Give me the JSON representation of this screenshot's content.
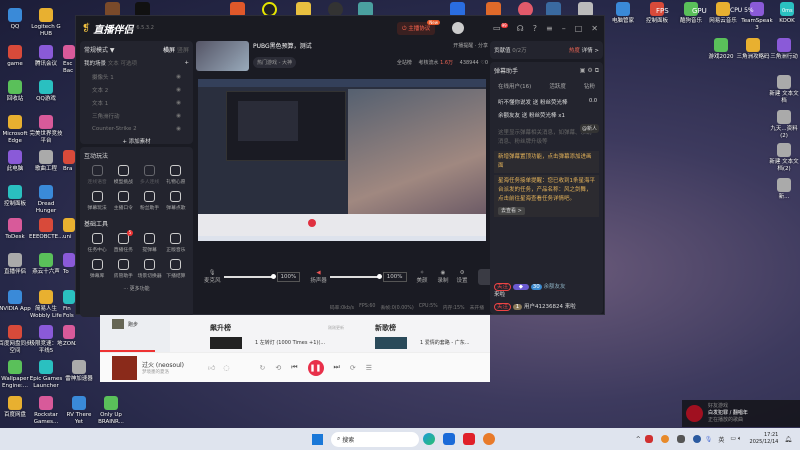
{
  "desktop": {
    "col1": [
      "QQ",
      "game",
      "回收站",
      "Microsoft Edge",
      "此电脑",
      "控制面板",
      "ToDesk",
      "直播伴侣",
      "NVIDIA App",
      "百度网盘同步空间",
      "Wallpaper Engine:...",
      "百度网盘"
    ],
    "col2": [
      "Logitech G HUB",
      "腾讯会议",
      "QQ游戏",
      "完美世界竞技平台",
      "歌曲工程",
      "Dread Hunger",
      "EEEOBCTE...",
      "燕云十六声",
      "简易人生 Wobbly Life",
      "极限竞速：地平线5",
      "Epic Games Launcher",
      "Rockstar Games..."
    ],
    "col3": [
      "",
      "Esc Bac",
      "",
      "",
      "Bra",
      "",
      "uni",
      "To",
      "Fin Fols",
      "ZONZ",
      "雷神加速器",
      "RV There Yet"
    ],
    "col4_bottom": "Only Up BRAINR...",
    "right_top": [
      "电脑管家",
      "控制面板",
      "酷狗音乐",
      "网易云音乐",
      "TeamSpeak 3",
      "KOOK"
    ],
    "right_row2": [
      "游戏2020",
      "三角洲攻略码",
      "三角洲行动"
    ],
    "right_col": [
      "新建 文本文档",
      "九天...资料(2)",
      "新建 文本文档(2)",
      "新..."
    ],
    "overlay": {
      "fps": "FPS",
      "gpu": "GPU",
      "cpu": "CPU 5%",
      "ping": "0ms"
    }
  },
  "app": {
    "title": "直播伴侣",
    "version": "6.5.3.2",
    "anchor_btn": "主播协议",
    "new_badge": "New",
    "msg_count": "99",
    "left": {
      "mode": "常规模式 ▼",
      "tab_a": "横屏",
      "tab_b": "竖屏",
      "sources_tabs": [
        "我的场景",
        "文本",
        "可选项"
      ],
      "sources": [
        "摄像头 1",
        "文本 2",
        "文本 1",
        "三角洲行动",
        "Counter-Strike 2"
      ],
      "add_source": "+ 添加素材",
      "interact_title": "互动玩法",
      "interact": [
        "连线语音",
        "模型挑战",
        "多人连线",
        "礼物心愿",
        "弹幕玩法",
        "主播口令",
        "粉丝助手",
        "弹幕点歌"
      ],
      "tools_title": "基础工具",
      "tools": [
        "任务中心",
        "直播任务",
        "提弹幕",
        "正版音乐",
        "弹幕库",
        "房管助手",
        "场景切换器",
        "下播结算"
      ],
      "tools_badge": "5",
      "more": "··· 更多功能"
    },
    "center": {
      "stream_title": "PUBG黑色预算，测试",
      "category": "热门游戏 - 大神",
      "start_notify": "开播提醒",
      "share": "分享",
      "stats": {
        "all": "全站榜",
        "flow_label": "考核流水",
        "flow": "1.6万",
        "hot": "438944",
        "likes": "0"
      },
      "mic_label": "麦克风",
      "mic_pct": "100%",
      "speaker_label": "扬声器",
      "speaker_pct": "100%",
      "beauty": "美颜",
      "record": "录制",
      "settings": "设置",
      "connect": "连接中...",
      "status": [
        "码率:0kb/s",
        "FPS:60",
        "丢帧:0(0.00%)",
        "CPU:5%",
        "内存:15%",
        "未开播"
      ]
    },
    "right": {
      "contrib": "贡献值",
      "contrib_val": "0/2万",
      "hot": "热度",
      "detail": "详情 >",
      "assistant": "弹幕助手",
      "tabs": [
        "在线用户(16)",
        "活跃度",
        "钻粉"
      ],
      "gifts": [
        "听不懂你说发 送 粉丝荧光棒",
        "余额友友 送 粉丝荧光棒 x1"
      ],
      "gift_count": "0.0",
      "member": "@新人",
      "hint": "这里显示弹幕相关消息，如弹幕、系统消息、粉丝牌升级等",
      "notice1": "新增弹幕置顶功能，点击弹幕添加进画面",
      "notice2": "星海任务接单提醒：您已收到1条星海平台派发的任务，产品名称：风之剑舞，点击前往星海查看任务详情吧。",
      "goto": "去查看 >",
      "follow": "关注",
      "lv": "30",
      "user1": "余额友友",
      "joined": "来啦",
      "user2": "用户41236824 来啦",
      "badge2": "1"
    }
  },
  "music": {
    "side_item": "跑步",
    "chart1": "飙升榜",
    "chart1_update": "刚刚更新",
    "chart1_song": "1  左转灯 (1000 Times +1)(...",
    "chart2": "新歌榜",
    "chart2_song": "1  爱情的套路 - 广东...",
    "song": "过火 (neosoul)",
    "artist": "梦境墨的夏洛"
  },
  "taskbar": {
    "search": "搜索",
    "ime": "英",
    "time": "17:21",
    "date": "2025/12/14"
  },
  "notify": {
    "app": "好友游戏",
    "title": "白发犯罪 / 翻唱年",
    "sub": "正在播放的歌曲"
  }
}
